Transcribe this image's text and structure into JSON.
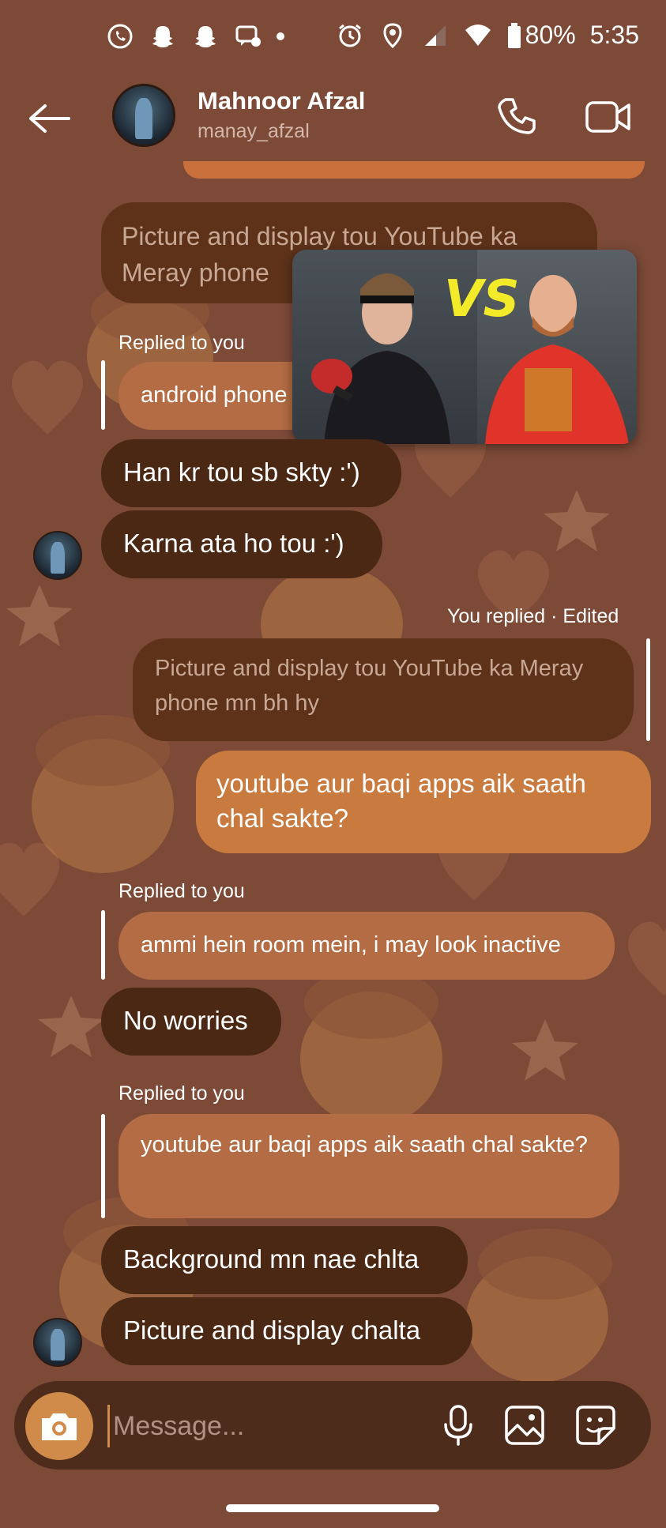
{
  "status_bar": {
    "battery": "80%",
    "time": "5:35"
  },
  "header": {
    "name": "Mahnoor Afzal",
    "handle": "manay_afzal"
  },
  "pip_video": {
    "overlay_text": "VS"
  },
  "messages": [
    {
      "quote_top": "Picture and display tou YouTube ka Meray phone"
    },
    {
      "reply_label": "Replied to you",
      "quote": "android phone"
    },
    {
      "text": "Han kr tou sb skty :')"
    },
    {
      "text": "Karna ata ho tou :')"
    },
    {
      "reply_label": "You replied · Edited",
      "quote": "Picture and display tou YouTube ka Meray phone mn bh hy",
      "text": "youtube aur baqi apps aik saath chal sakte?"
    },
    {
      "reply_label": "Replied to you",
      "quote": "ammi hein room mein, i may look inactive"
    },
    {
      "text": "No worries"
    },
    {
      "reply_label": "Replied to you",
      "quote": "youtube aur baqi apps aik saath chal sakte?"
    },
    {
      "text": "Background mn nae chlta"
    },
    {
      "text": "Picture and display chalta"
    }
  ],
  "composer": {
    "placeholder": "Message..."
  },
  "colors": {
    "background": "#7d4a38",
    "received_bubble": "#4b2813",
    "sent_bubble": "#c97a3e",
    "quote_bubble": "#b36c43",
    "accent": "#d08a4a"
  }
}
